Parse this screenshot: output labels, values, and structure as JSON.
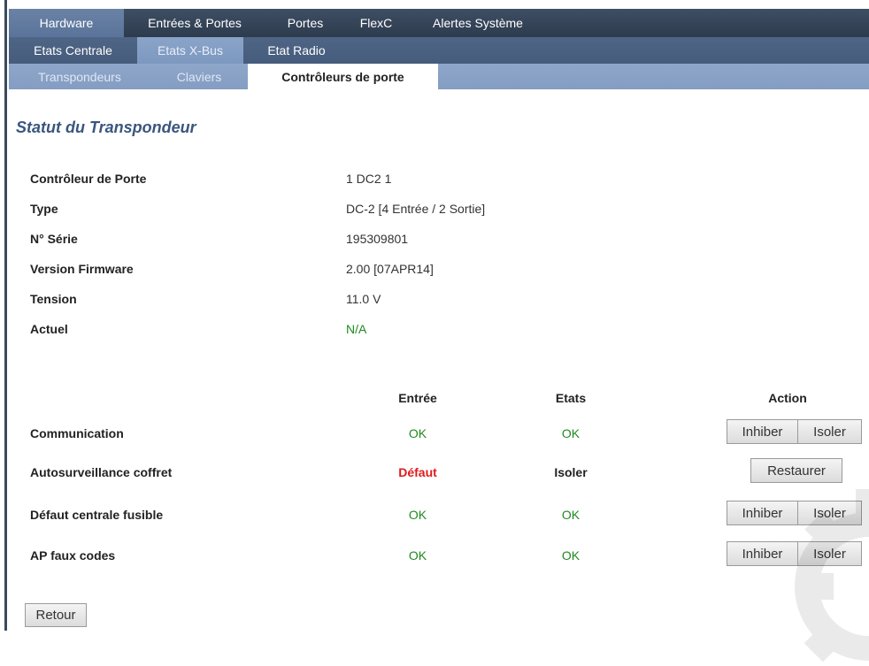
{
  "nav": {
    "row1": [
      "Hardware",
      "Entrées & Portes",
      "Portes",
      "FlexC",
      "Alertes Système"
    ],
    "row2": [
      "Etats Centrale",
      "Etats X-Bus",
      "Etat Radio"
    ],
    "row3": [
      "Transpondeurs",
      "Claviers",
      "Contrôleurs de porte"
    ]
  },
  "page_title": "Statut du Transpondeur",
  "info": {
    "controller_label": "Contrôleur de Porte",
    "controller_value": "1 DC2 1",
    "type_label": "Type",
    "type_value": "DC-2 [4 Entrée / 2 Sortie]",
    "serial_label": "N° Série",
    "serial_value": "195309801",
    "firmware_label": "Version Firmware",
    "firmware_value": "2.00 [07APR14]",
    "voltage_label": "Tension",
    "voltage_value": "11.0 V",
    "current_label": "Actuel",
    "current_value": "N/A"
  },
  "status_table": {
    "headers": {
      "input": "Entrée",
      "state": "Etats",
      "action": "Action"
    },
    "rows": [
      {
        "label": "Communication",
        "input": "OK",
        "state": "OK",
        "btn1": "Inhiber",
        "btn2": "Isoler"
      },
      {
        "label": "Autosurveillance coffret",
        "input": "Défaut",
        "state": "Isoler",
        "btn1": "Restaurer"
      },
      {
        "label": "Défaut centrale fusible",
        "input": "OK",
        "state": "OK",
        "btn1": "Inhiber",
        "btn2": "Isoler"
      },
      {
        "label": "AP faux codes",
        "input": "OK",
        "state": "OK",
        "btn1": "Inhiber",
        "btn2": "Isoler"
      }
    ]
  },
  "back_button": "Retour",
  "colors": {
    "ok": "#1f8a1f",
    "fault": "#e01b1b",
    "title": "#3a567f"
  }
}
